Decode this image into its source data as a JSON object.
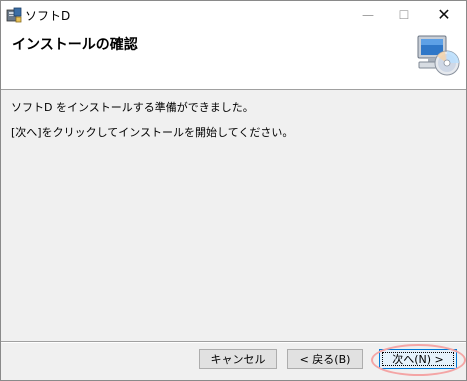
{
  "window": {
    "title": "ソフトD",
    "controls": {
      "minimize": "—",
      "maximize": "☐",
      "close": "✕"
    }
  },
  "header": {
    "title": "インストールの確認",
    "graphic": "computer-cd-icon"
  },
  "body": {
    "line1": "ソフトD をインストールする準備ができました。",
    "line2": "[次へ]をクリックしてインストールを開始してください。"
  },
  "buttons": {
    "cancel": "キャンセル",
    "back": "< 戻る(B)",
    "next": "次へ(N) >"
  },
  "colors": {
    "accent": "#0078d7",
    "highlight": "#f4a5a5"
  }
}
